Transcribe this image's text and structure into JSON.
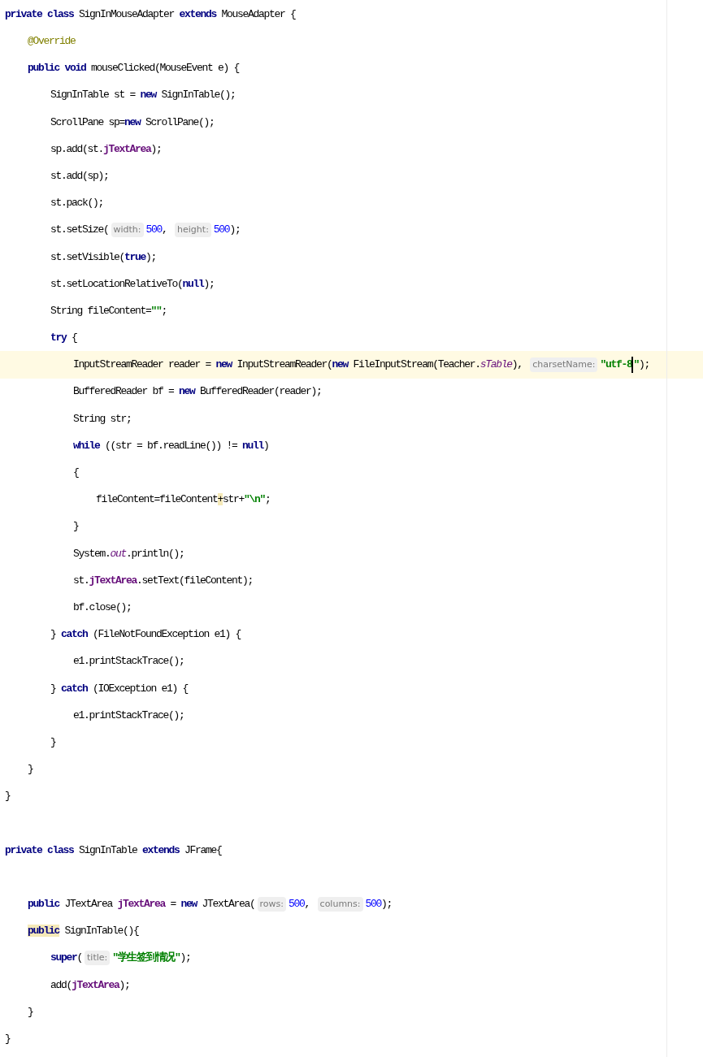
{
  "editor": {
    "lines": [
      {
        "kind": "code",
        "tokens": [
          {
            "kind": "keyword",
            "text": "private class "
          },
          {
            "kind": "plain",
            "text": "SignInMouseAdapter "
          },
          {
            "kind": "keyword",
            "text": "extends "
          },
          {
            "kind": "plain",
            "text": "MouseAdapter {"
          }
        ],
        "children": [
          {
            "kind": "code",
            "tokens": [
              {
                "kind": "annotation",
                "text": "@Override"
              }
            ]
          },
          {
            "kind": "code",
            "tokens": [
              {
                "kind": "keyword",
                "text": "public void "
              },
              {
                "kind": "plain",
                "text": "mouseClicked(MouseEvent e) {"
              }
            ],
            "children": [
              {
                "kind": "code",
                "tokens": [
                  {
                    "kind": "plain",
                    "text": "SignInTable st = "
                  },
                  {
                    "kind": "keyword",
                    "text": "new "
                  },
                  {
                    "kind": "plain",
                    "text": "SignInTable();"
                  }
                ]
              },
              {
                "kind": "code",
                "tokens": [
                  {
                    "kind": "plain",
                    "text": "ScrollPane sp="
                  },
                  {
                    "kind": "keyword",
                    "text": "new "
                  },
                  {
                    "kind": "plain",
                    "text": "ScrollPane();"
                  }
                ]
              },
              {
                "kind": "code",
                "tokens": [
                  {
                    "kind": "plain",
                    "text": "sp.add(st."
                  },
                  {
                    "kind": "field",
                    "text": "jTextArea"
                  },
                  {
                    "kind": "plain",
                    "text": ");"
                  }
                ]
              },
              {
                "kind": "code",
                "tokens": [
                  {
                    "kind": "plain",
                    "text": "st.add(sp);"
                  }
                ]
              },
              {
                "kind": "code",
                "tokens": [
                  {
                    "kind": "plain",
                    "text": "st.pack();"
                  }
                ]
              },
              {
                "kind": "code",
                "tokens": [
                  {
                    "kind": "plain",
                    "text": "st.setSize("
                  },
                  {
                    "kind": "hint",
                    "text": "width:"
                  },
                  {
                    "kind": "number",
                    "text": "500"
                  },
                  {
                    "kind": "plain",
                    "text": ", "
                  },
                  {
                    "kind": "hint",
                    "text": "height:"
                  },
                  {
                    "kind": "number",
                    "text": "500"
                  },
                  {
                    "kind": "plain",
                    "text": ");"
                  }
                ]
              },
              {
                "kind": "code",
                "tokens": [
                  {
                    "kind": "plain",
                    "text": "st.setVisible("
                  },
                  {
                    "kind": "keyword",
                    "text": "true"
                  },
                  {
                    "kind": "plain",
                    "text": ");"
                  }
                ]
              },
              {
                "kind": "code",
                "tokens": [
                  {
                    "kind": "plain",
                    "text": "st.setLocationRelativeTo("
                  },
                  {
                    "kind": "keyword",
                    "text": "null"
                  },
                  {
                    "kind": "plain",
                    "text": ");"
                  }
                ]
              },
              {
                "kind": "code",
                "tokens": [
                  {
                    "kind": "plain",
                    "text": "String fileContent="
                  },
                  {
                    "kind": "string",
                    "text": "\"\""
                  },
                  {
                    "kind": "plain",
                    "text": ";"
                  }
                ]
              },
              {
                "kind": "code",
                "tokens": [
                  {
                    "kind": "keyword",
                    "text": "try "
                  },
                  {
                    "kind": "plain",
                    "text": "{"
                  }
                ],
                "children": [
                  {
                    "kind": "code",
                    "current": true,
                    "tokens": [
                      {
                        "kind": "plain",
                        "text": "InputStreamReader reader = "
                      },
                      {
                        "kind": "keyword",
                        "text": "new "
                      },
                      {
                        "kind": "plain",
                        "text": "InputStreamReader("
                      },
                      {
                        "kind": "keyword",
                        "text": "new "
                      },
                      {
                        "kind": "plain",
                        "text": "FileInputStream(Teacher."
                      },
                      {
                        "kind": "static",
                        "text": "sTable"
                      },
                      {
                        "kind": "plain",
                        "text": "), "
                      },
                      {
                        "kind": "hint",
                        "text": "charsetName:"
                      },
                      {
                        "kind": "string",
                        "text": "\"utf-8",
                        "caret": true
                      },
                      {
                        "kind": "string",
                        "text": "\""
                      },
                      {
                        "kind": "plain",
                        "text": ");"
                      }
                    ]
                  },
                  {
                    "kind": "code",
                    "tokens": [
                      {
                        "kind": "plain",
                        "text": "BufferedReader bf = "
                      },
                      {
                        "kind": "keyword",
                        "text": "new "
                      },
                      {
                        "kind": "plain",
                        "text": "BufferedReader(reader);"
                      }
                    ]
                  },
                  {
                    "kind": "code",
                    "tokens": [
                      {
                        "kind": "plain",
                        "text": "String str;"
                      }
                    ]
                  },
                  {
                    "kind": "code",
                    "tokens": [
                      {
                        "kind": "keyword",
                        "text": "while "
                      },
                      {
                        "kind": "plain",
                        "text": "((str = bf.readLine()) != "
                      },
                      {
                        "kind": "keyword",
                        "text": "null"
                      },
                      {
                        "kind": "plain",
                        "text": ")"
                      }
                    ]
                  },
                  {
                    "kind": "code",
                    "tokens": [
                      {
                        "kind": "plain",
                        "text": "{"
                      }
                    ],
                    "children": [
                      {
                        "kind": "code",
                        "tokens": [
                          {
                            "kind": "plain",
                            "text": "fileContent=fileContent"
                          },
                          {
                            "kind": "plain",
                            "text": "+",
                            "highlight": true
                          },
                          {
                            "kind": "plain",
                            "text": "str+"
                          },
                          {
                            "kind": "string",
                            "text": "\"\\n\""
                          },
                          {
                            "kind": "plain",
                            "text": ";"
                          }
                        ]
                      }
                    ]
                  },
                  {
                    "kind": "code",
                    "tokens": [
                      {
                        "kind": "plain",
                        "text": "}"
                      }
                    ]
                  },
                  {
                    "kind": "code",
                    "tokens": [
                      {
                        "kind": "plain",
                        "text": "System."
                      },
                      {
                        "kind": "static",
                        "text": "out"
                      },
                      {
                        "kind": "plain",
                        "text": ".println();"
                      }
                    ]
                  },
                  {
                    "kind": "code",
                    "tokens": [
                      {
                        "kind": "plain",
                        "text": "st."
                      },
                      {
                        "kind": "field",
                        "text": "jTextArea"
                      },
                      {
                        "kind": "plain",
                        "text": ".setText(fileContent);"
                      }
                    ]
                  },
                  {
                    "kind": "code",
                    "tokens": [
                      {
                        "kind": "plain",
                        "text": "bf.close();"
                      }
                    ]
                  }
                ]
              },
              {
                "kind": "code",
                "tokens": [
                  {
                    "kind": "plain",
                    "text": "} "
                  },
                  {
                    "kind": "keyword",
                    "text": "catch "
                  },
                  {
                    "kind": "plain",
                    "text": "(FileNotFoundException e1) {"
                  }
                ],
                "children": [
                  {
                    "kind": "code",
                    "tokens": [
                      {
                        "kind": "plain",
                        "text": "e1.printStackTrace();"
                      }
                    ]
                  }
                ]
              },
              {
                "kind": "code",
                "tokens": [
                  {
                    "kind": "plain",
                    "text": "} "
                  },
                  {
                    "kind": "keyword",
                    "text": "catch "
                  },
                  {
                    "kind": "plain",
                    "text": "(IOException e1) {"
                  }
                ],
                "children": [
                  {
                    "kind": "code",
                    "tokens": [
                      {
                        "kind": "plain",
                        "text": "e1.printStackTrace();"
                      }
                    ]
                  }
                ]
              },
              {
                "kind": "code",
                "tokens": [
                  {
                    "kind": "plain",
                    "text": "}"
                  }
                ]
              }
            ]
          },
          {
            "kind": "code",
            "tokens": [
              {
                "kind": "plain",
                "text": "}"
              }
            ]
          }
        ]
      },
      {
        "kind": "code",
        "tokens": [
          {
            "kind": "plain",
            "text": "}"
          }
        ]
      },
      {
        "kind": "blank"
      },
      {
        "kind": "code",
        "tokens": [
          {
            "kind": "keyword",
            "text": "private class "
          },
          {
            "kind": "plain",
            "text": "SignInTable "
          },
          {
            "kind": "keyword",
            "text": "extends "
          },
          {
            "kind": "plain",
            "text": "JFrame{"
          }
        ],
        "children": [
          {
            "kind": "blank"
          },
          {
            "kind": "code",
            "tokens": [
              {
                "kind": "keyword",
                "text": "public "
              },
              {
                "kind": "plain",
                "text": "JTextArea "
              },
              {
                "kind": "field",
                "text": "jTextArea"
              },
              {
                "kind": "plain",
                "text": " = "
              },
              {
                "kind": "keyword",
                "text": "new "
              },
              {
                "kind": "plain",
                "text": "JTextArea("
              },
              {
                "kind": "hint",
                "text": "rows:"
              },
              {
                "kind": "number",
                "text": "500"
              },
              {
                "kind": "plain",
                "text": ", "
              },
              {
                "kind": "hint",
                "text": "columns:"
              },
              {
                "kind": "number",
                "text": "500"
              },
              {
                "kind": "plain",
                "text": ");"
              }
            ]
          },
          {
            "kind": "code",
            "tokens": [
              {
                "kind": "keyword",
                "text": "public",
                "highlight": true
              },
              {
                "kind": "plain",
                "text": " SignInTable(){"
              }
            ],
            "children": [
              {
                "kind": "code",
                "tokens": [
                  {
                    "kind": "keyword",
                    "text": "super"
                  },
                  {
                    "kind": "plain",
                    "text": "("
                  },
                  {
                    "kind": "hint",
                    "text": "title:"
                  },
                  {
                    "kind": "string",
                    "text": "\"学生签到情况\""
                  },
                  {
                    "kind": "plain",
                    "text": ");"
                  }
                ]
              },
              {
                "kind": "code",
                "tokens": [
                  {
                    "kind": "plain",
                    "text": "add("
                  },
                  {
                    "kind": "field",
                    "text": "jTextArea"
                  },
                  {
                    "kind": "plain",
                    "text": ");"
                  }
                ]
              }
            ]
          },
          {
            "kind": "code",
            "tokens": [
              {
                "kind": "plain",
                "text": "}"
              }
            ]
          }
        ]
      },
      {
        "kind": "code",
        "tokens": [
          {
            "kind": "plain",
            "text": "}"
          }
        ]
      }
    ]
  }
}
